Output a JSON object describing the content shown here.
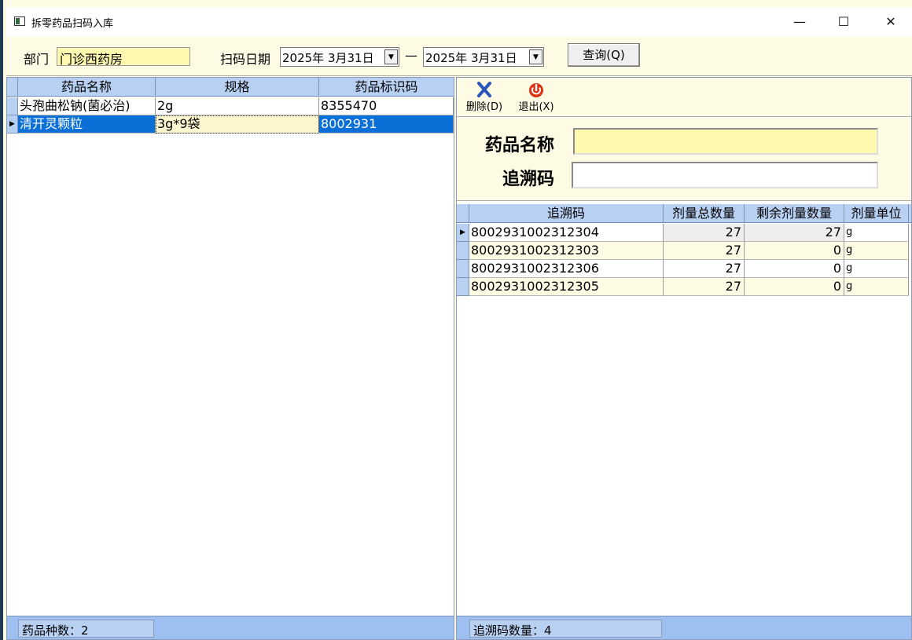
{
  "window": {
    "title": "拆零药品扫码入库",
    "minimize": "—",
    "maximize": "☐",
    "close": "✕"
  },
  "filter": {
    "dept_label": "部门",
    "dept_value": "门诊西药房",
    "scan_date_label": "扫码日期",
    "date_from": "2025年 3月31日",
    "date_sep": "—",
    "date_to": "2025年 3月31日",
    "query_button": "查询(Q)"
  },
  "left_grid": {
    "columns": [
      "药品名称",
      "规格",
      "药品标识码"
    ],
    "rows": [
      {
        "name": "头孢曲松钠(菌必治)",
        "spec": "2g",
        "code": "8355470",
        "selected": false
      },
      {
        "name": "清开灵颗粒",
        "spec": "3g*9袋",
        "code": "8002931",
        "selected": true
      }
    ],
    "footer": "药品种数：2"
  },
  "toolbar": {
    "delete_label": "删除(D)",
    "exit_label": "退出(X)",
    "delete_icon": "x-icon",
    "exit_icon": "power-icon"
  },
  "form": {
    "drug_name_label": "药品名称",
    "drug_name_value": "",
    "trace_code_label": "追溯码",
    "trace_code_value": ""
  },
  "right_grid": {
    "columns": [
      "追溯码",
      "剂量总数量",
      "剩余剂量数量",
      "剂量单位"
    ],
    "rows": [
      {
        "code": "8002931002312304",
        "total": "27",
        "remain": "27",
        "unit": "g",
        "current": true
      },
      {
        "code": "8002931002312303",
        "total": "27",
        "remain": "0",
        "unit": "g",
        "current": false
      },
      {
        "code": "8002931002312306",
        "total": "27",
        "remain": "0",
        "unit": "g",
        "current": false
      },
      {
        "code": "8002931002312305",
        "total": "27",
        "remain": "0",
        "unit": "g",
        "current": false
      }
    ],
    "footer": "追溯码数量：4"
  },
  "colors": {
    "selected_row": "#0a6fd6",
    "header_bg": "#b8d0f2",
    "footer_bg": "#9ec0f0",
    "input_yellow": "#fff9b0",
    "panel_bg": "#fdfbe4"
  }
}
